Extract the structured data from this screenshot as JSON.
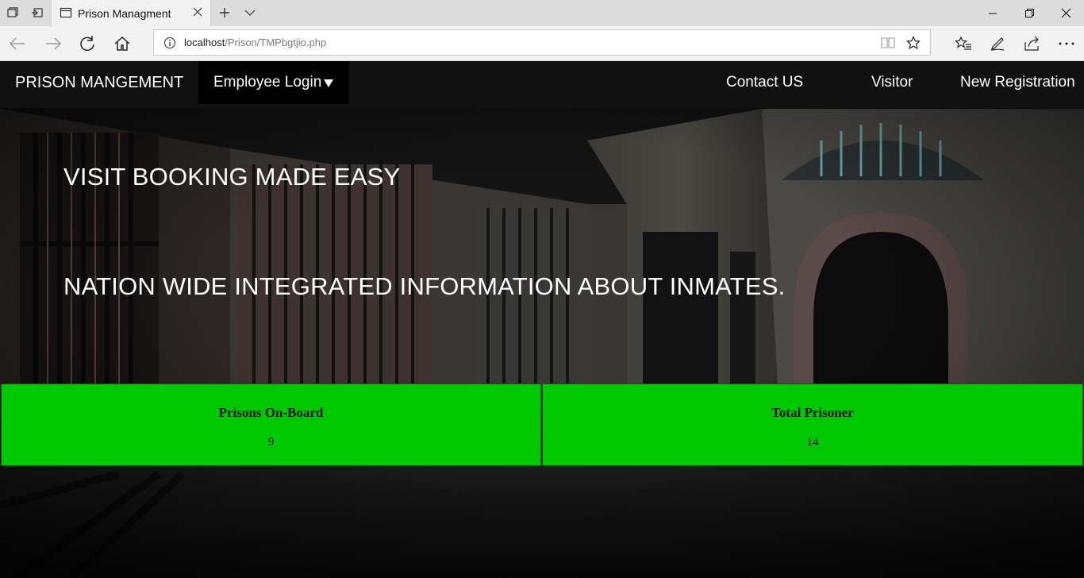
{
  "browser": {
    "tab_title": "Prison Managment",
    "url_host": "localhost",
    "url_path": "/Prison/TMPbgtjio.php"
  },
  "nav": {
    "brand": "PRISON MANGEMENT",
    "employee_login": "Employee Login",
    "contact": "Contact US",
    "visitor": "Visitor",
    "registration": "New Registration"
  },
  "hero": {
    "headline_1": "VISIT BOOKING MADE EASY",
    "headline_2": "NATION WIDE INTEGRATED INFORMATION ABOUT INMATES."
  },
  "stats": [
    {
      "label": "Prisons On-Board",
      "value": "9"
    },
    {
      "label": "Total Prisoner",
      "value": "14"
    }
  ],
  "colors": {
    "stat_background": "#00c800",
    "navbar": "#111111",
    "dropdown": "#000000"
  }
}
